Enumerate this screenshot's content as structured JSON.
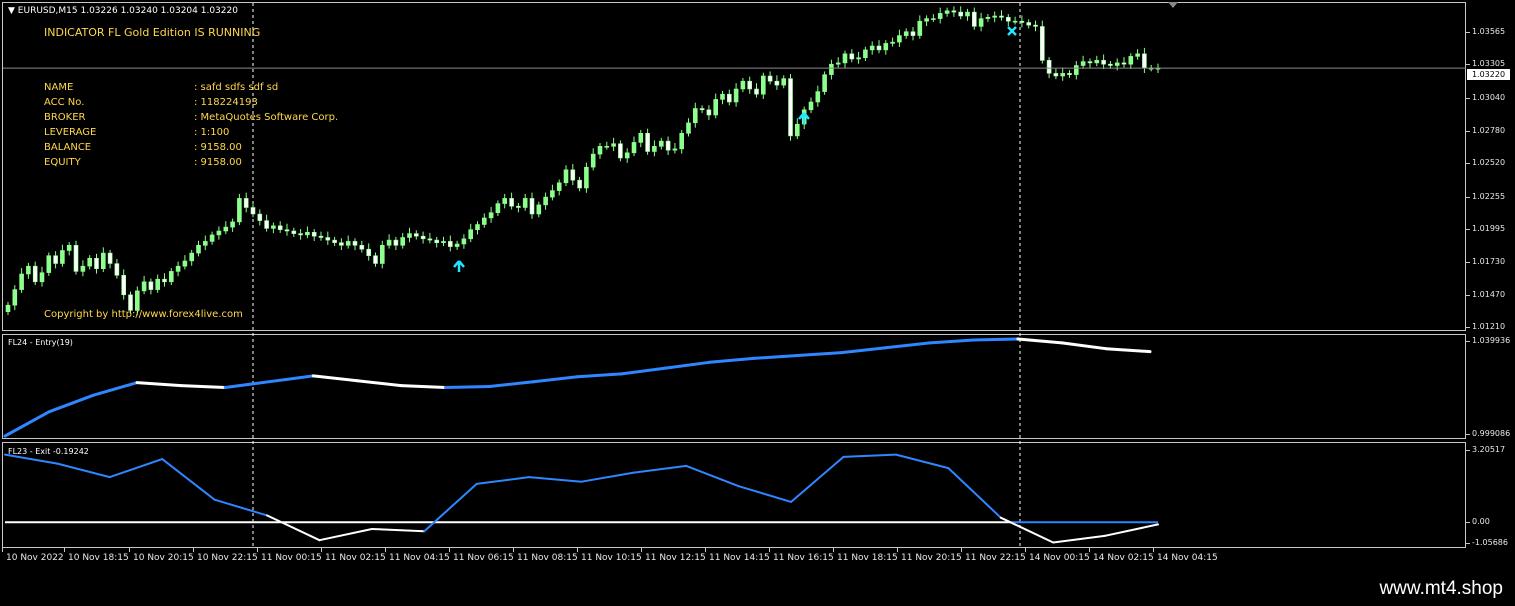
{
  "window": {
    "symbol_line": "EURUSD,M15  1.03226 1.03240 1.03204 1.03220",
    "indicator_title": "INDICATOR FL Gold Edition IS RUNNING",
    "copyright": "Copyright by http://www.forex4live.com",
    "current_price": "1.03220"
  },
  "account_info": [
    {
      "key": "NAME",
      "value": ": safd   sdfs sdf sd"
    },
    {
      "key": "ACC No.",
      "value": ": 118224193"
    },
    {
      "key": "BROKER",
      "value": ": MetaQuotes Software Corp."
    },
    {
      "key": "LEVERAGE",
      "value": ": 1:100"
    },
    {
      "key": "BALANCE",
      "value": ": 9158.00"
    },
    {
      "key": "EQUITY",
      "value": ": 9158.00"
    }
  ],
  "price_axis": [
    "1.03565",
    "1.03305",
    "1.03040",
    "1.02780",
    "1.02520",
    "1.02255",
    "1.01995",
    "1.01730",
    "1.01470",
    "1.01210"
  ],
  "entry_pane": {
    "label": "FL24 - Entry(19)",
    "axis": [
      "1.039936",
      "0.999086"
    ]
  },
  "exit_pane": {
    "label": "FL23 - Exit -0.19242",
    "axis": [
      "3.20517",
      "0.00",
      "-1.05686"
    ]
  },
  "time_axis": [
    "10 Nov 2022",
    "10 Nov 18:15",
    "10 Nov 20:15",
    "10 Nov 22:15",
    "11 Nov 00:15",
    "11 Nov 02:15",
    "11 Nov 04:15",
    "11 Nov 06:15",
    "11 Nov 08:15",
    "11 Nov 10:15",
    "11 Nov 12:15",
    "11 Nov 14:15",
    "11 Nov 16:15",
    "11 Nov 18:15",
    "11 Nov 20:15",
    "11 Nov 22:15",
    "14 Nov 00:15",
    "14 Nov 02:15",
    "14 Nov 04:15"
  ],
  "watermark": "www.mt4.shop",
  "colors": {
    "bull": "#8cff8c",
    "bear": "#ffffff",
    "signal": "#22e5ff",
    "entry_blue": "#2f86ff",
    "exit_blue": "#2f86ff",
    "text_yellow": "#ffd84a"
  },
  "chart_data": [
    {
      "type": "candlestick",
      "title": "EURUSD,M15",
      "ylim": [
        1.0121,
        1.0372
      ],
      "close": [
        1.014,
        1.0152,
        1.0164,
        1.017,
        1.0158,
        1.0165,
        1.0178,
        1.0172,
        1.0182,
        1.0186,
        1.0166,
        1.017,
        1.0176,
        1.0168,
        1.018,
        1.0172,
        1.0163,
        1.0148,
        1.0136,
        1.0151,
        1.0158,
        1.0152,
        1.016,
        1.0158,
        1.0166,
        1.017,
        1.0174,
        1.018,
        1.0186,
        1.0189,
        1.0194,
        1.0197,
        1.02,
        1.0204,
        1.0222,
        1.0215,
        1.021,
        1.0205,
        1.0199,
        1.0201,
        1.0198,
        1.0197,
        1.0195,
        1.0194,
        1.0196,
        1.0193,
        1.0192,
        1.019,
        1.0188,
        1.0186,
        1.0189,
        1.0186,
        1.0183,
        1.0178,
        1.0172,
        1.0186,
        1.019,
        1.0186,
        1.0192,
        1.0195,
        1.0193,
        1.0191,
        1.019,
        1.0188,
        1.0189,
        1.0185,
        1.0187,
        1.0191,
        1.0198,
        1.0202,
        1.0207,
        1.0211,
        1.0218,
        1.0222,
        1.0216,
        1.0215,
        1.0222,
        1.021,
        1.0217,
        1.0223,
        1.0228,
        1.0234,
        1.0244,
        1.0236,
        1.023,
        1.0246,
        1.0256,
        1.0262,
        1.0262,
        1.0264,
        1.0253,
        1.0257,
        1.0265,
        1.0272,
        1.0258,
        1.0262,
        1.0266,
        1.0259,
        1.026,
        1.0272,
        1.028,
        1.0291,
        1.029,
        1.0286,
        1.0298,
        1.0302,
        1.0296,
        1.0306,
        1.0312,
        1.0306,
        1.0302,
        1.0316,
        1.0312,
        1.0309,
        1.0314,
        1.027,
        1.0279,
        1.029,
        1.0296,
        1.0304,
        1.0317,
        1.0325,
        1.0326,
        1.0333,
        1.0329,
        1.033,
        1.0336,
        1.0339,
        1.0336,
        1.0341,
        1.0342,
        1.0347,
        1.035,
        1.0347,
        1.0358,
        1.036,
        1.036,
        1.0364,
        1.0366,
        1.0365,
        1.0362,
        1.0365,
        1.0354,
        1.036,
        1.0361,
        1.0362,
        1.0361,
        1.0358,
        1.0358,
        1.0357,
        1.0355,
        1.0354,
        1.0328,
        1.0318,
        1.0316,
        1.0318,
        1.0317,
        1.0324,
        1.0327,
        1.0326,
        1.0328,
        1.0325,
        1.0324,
        1.0326,
        1.0325,
        1.0331,
        1.0333,
        1.0322,
        1.0322,
        1.0322
      ]
    },
    {
      "type": "line",
      "title": "FL24 - Entry(19)",
      "ylim": [
        0.999086,
        1.039936
      ],
      "values": [
        0.0,
        0.25,
        0.42,
        0.55,
        0.52,
        0.5,
        0.56,
        0.62,
        0.57,
        0.52,
        0.5,
        0.51,
        0.56,
        0.61,
        0.64,
        0.7,
        0.76,
        0.8,
        0.83,
        0.86,
        0.91,
        0.96,
        0.99,
        1.0,
        0.96,
        0.9,
        0.87
      ]
    },
    {
      "type": "line",
      "title": "FL23 - Exit -0.19242",
      "ylim": [
        -1.05686,
        3.20517
      ],
      "values": [
        3.0,
        2.6,
        2.0,
        2.8,
        1.0,
        0.3,
        -0.8,
        -0.3,
        -0.4,
        1.7,
        2.0,
        1.8,
        2.2,
        2.5,
        1.6,
        0.9,
        2.9,
        3.0,
        2.4,
        0.2,
        -0.9,
        -0.6,
        -0.1
      ]
    }
  ]
}
